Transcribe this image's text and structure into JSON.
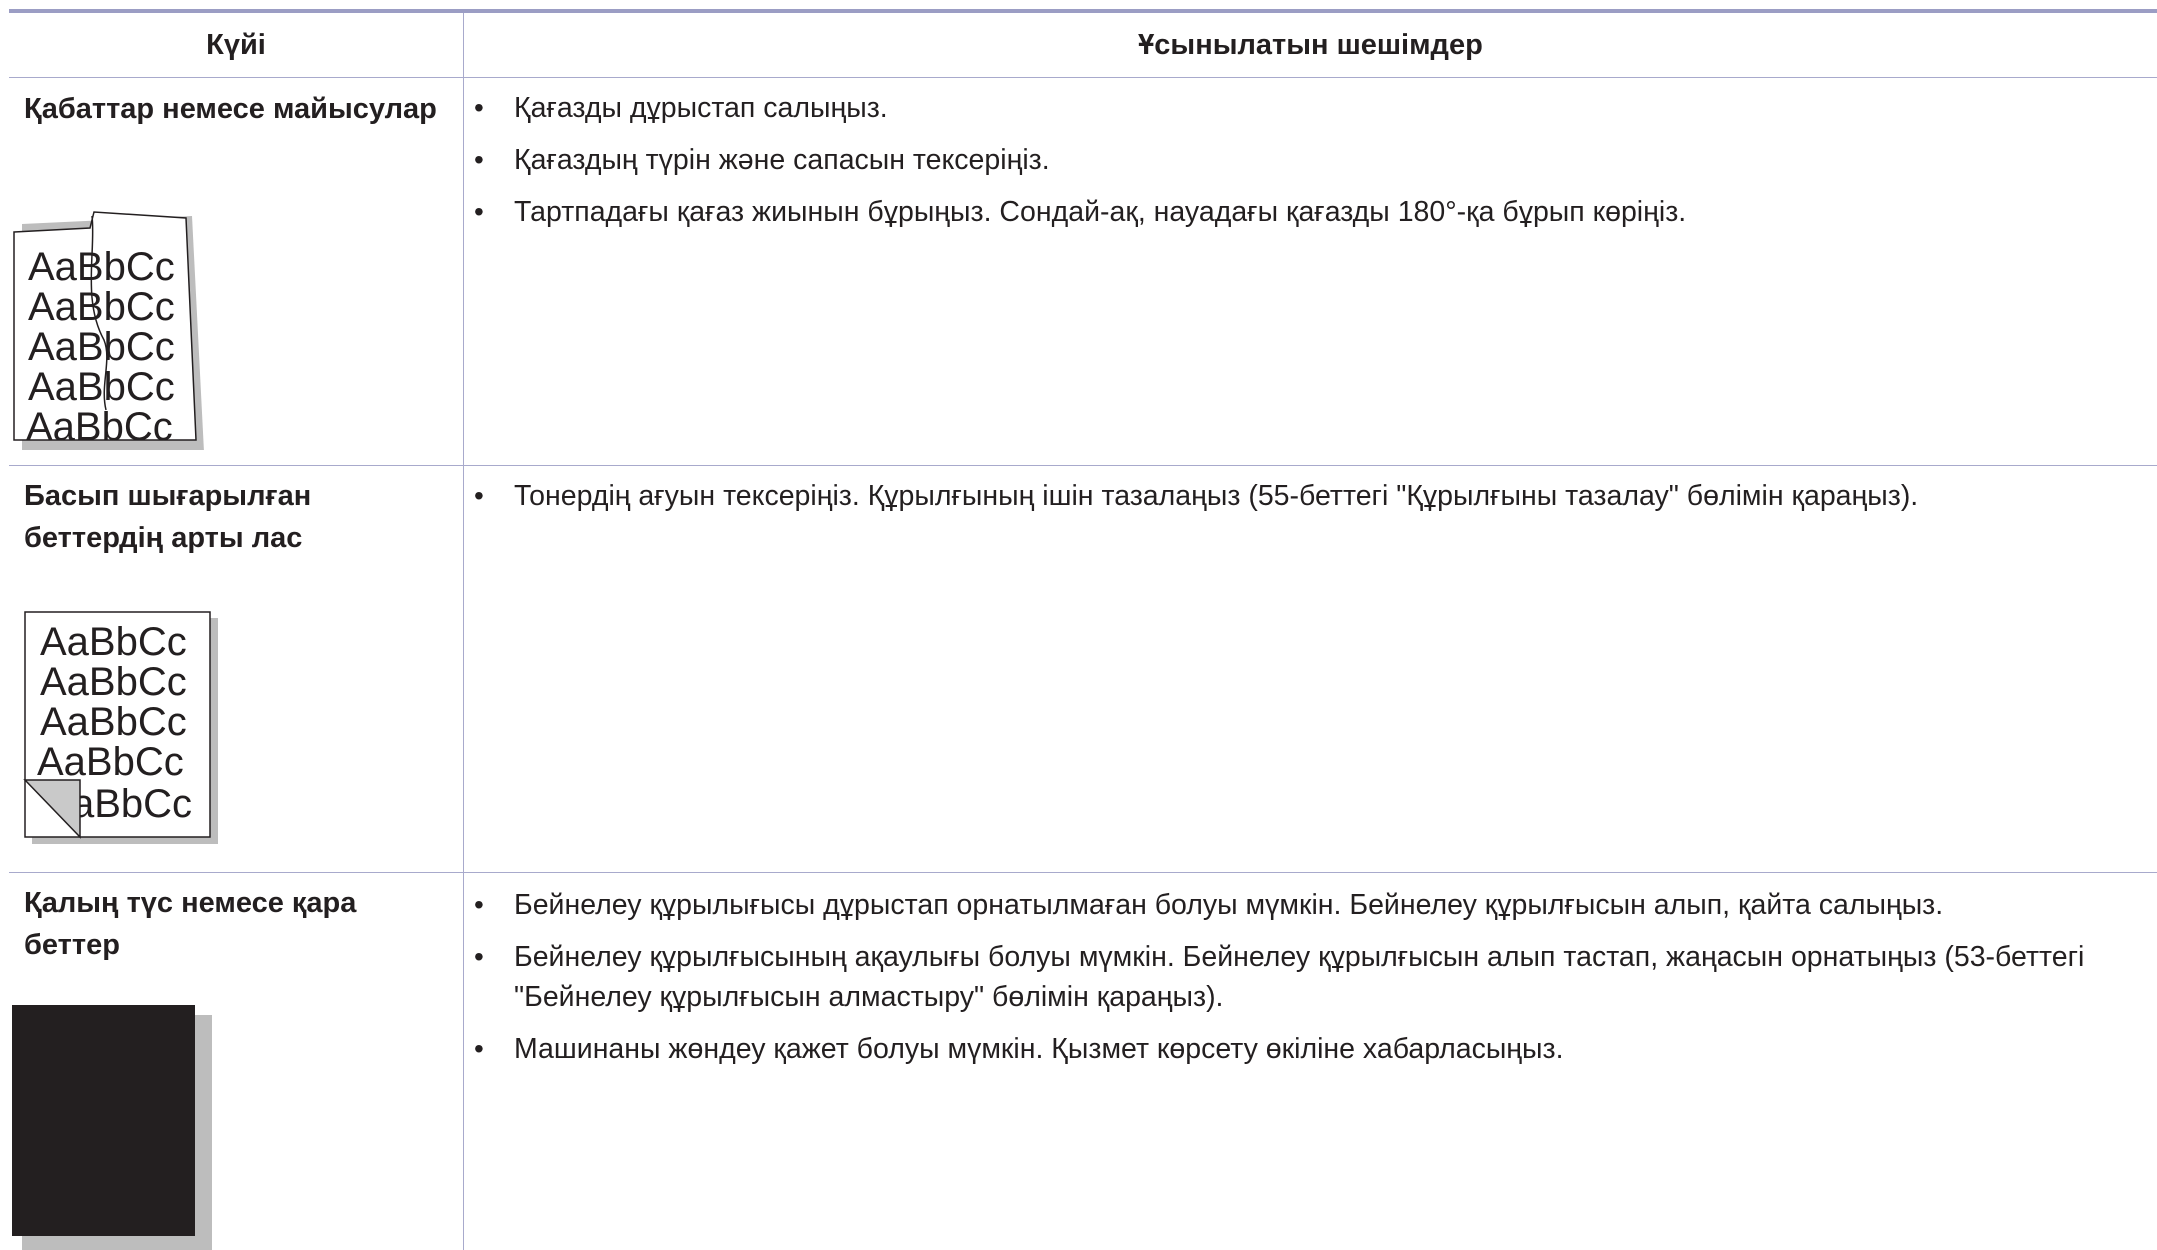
{
  "table": {
    "headers": {
      "condition": "Күйі",
      "solutions": "Ұсынылатын шешімдер"
    },
    "rows": [
      {
        "condition": "Қабаттар немесе майысулар",
        "solutions": [
          "Қағазды дұрыстап салыңыз.",
          "Қағаздың түрін және сапасын тексеріңіз.",
          "Тартпадағы қағаз жиынын бұрыңыз. Сондай-ақ, науадағы қағазды 180°-қа бұрып көріңіз."
        ],
        "sample_lines": [
          "AaBbCc",
          "AaBbCc",
          "AaBbCc",
          "AaBbCc",
          "AaBbCc"
        ]
      },
      {
        "condition": "Басып шығарылған беттердің арты лас",
        "solutions": [
          "Тонердің ағуын тексеріңіз. Құрылғының ішін тазалаңыз (55-беттегі \"Құрылғыны тазалау\" бөлімін қараңыз)."
        ],
        "sample_lines": [
          "AaBbCc",
          "AaBbCc",
          "AaBbCc",
          "AaBbCc",
          "aBbCc"
        ]
      },
      {
        "condition": "Қалың түс немесе қара беттер",
        "solutions": [
          "Бейнелеу құрылығысы дұрыстап орнатылмаған болуы мүмкін. Бейнелеу құрылғысын алып, қайта салыңыз.",
          "Бейнелеу құрылғысының ақаулығы болуы мүмкін. Бейнелеу құрылғысын алып тастап, жаңасын орнатыңыз (53-беттегі \"Бейнелеу құрылғысын алмастыру\" бөлімін қараңыз).",
          "Машинаны жөндеу қажет болуы мүмкін. Қызмет көрсету өкіліне хабарласыңыз."
        ]
      }
    ]
  },
  "colors": {
    "rule": "#9b9dc4",
    "grid": "#a8aacc",
    "text": "#231f20",
    "black_page": "#231f20",
    "shadow": "#bdbdbd"
  },
  "icons": {
    "bullet": "•"
  }
}
